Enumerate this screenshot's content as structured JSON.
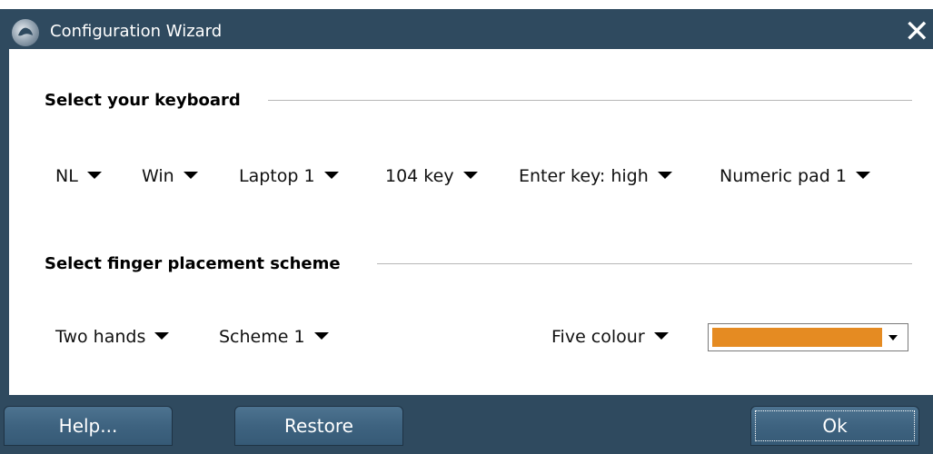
{
  "window": {
    "title": "Configuration Wizard",
    "close_glyph": "✕"
  },
  "keyboard_section": {
    "title": "Select your keyboard",
    "dropdowns": [
      {
        "label": "NL"
      },
      {
        "label": "Win"
      },
      {
        "label": "Laptop 1"
      },
      {
        "label": "104 key"
      },
      {
        "label": "Enter key: high"
      },
      {
        "label": "Numeric pad 1"
      }
    ]
  },
  "finger_section": {
    "title": "Select finger placement scheme",
    "dropdowns": [
      {
        "label": "Two hands"
      },
      {
        "label": "Scheme 1"
      },
      {
        "label": "Five colour"
      }
    ],
    "color_select": {
      "selected_color": "#e58b22"
    }
  },
  "footer": {
    "help_label": "Help...",
    "restore_label": "Restore",
    "ok_label": "Ok"
  },
  "colors": {
    "frame": "#2f4a5f",
    "button": "#3e6380",
    "swatch": "#e58b22"
  },
  "icons": {
    "app": "app-logo-icon",
    "close": "close-icon",
    "dropdown": "caret-down-icon"
  }
}
